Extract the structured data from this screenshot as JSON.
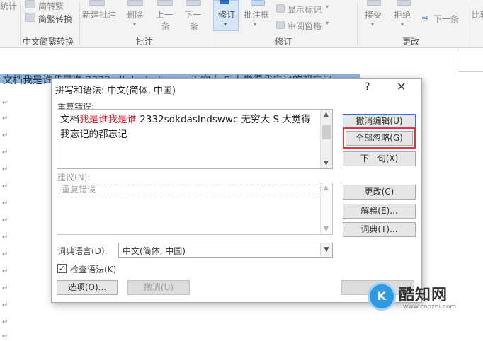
{
  "ribbon": {
    "stats_label": "统计",
    "trad_to_simp": "简转繁",
    "simp_trad_convert": "简繁转换",
    "new_comment": "新建批注",
    "delete_label": "删除",
    "prev_label": "上一",
    "prev_label2": "条",
    "next_label": "下一",
    "next_label2": "条",
    "track_label": "修订",
    "comment_box": "批注框",
    "show_markup": "显示标记",
    "review_pane": "审阅窗格",
    "accept": "接受",
    "reject": "拒绝",
    "next_change": "下一条",
    "compare": "比较",
    "groups": {
      "chinese_conversion": "中文简繁转换",
      "comments": "批注",
      "tracking": "修订",
      "changes": "更改"
    }
  },
  "document": {
    "selected_line": "文档我是谁我是谁 2332sdkdaslndswwc 无穷大 S 大觉得我忘记的都忘记"
  },
  "dialog": {
    "title": "拼写和语法: 中文(简体, 中国)",
    "help": "?",
    "close": "✕",
    "repeat_error_label": "重复错误:",
    "error_text_prefix": "文档",
    "error_text_highlight": "我是谁我是谁",
    "error_text_suffix": " 2332sdkdaslndswwc 无穷大 S 大觉得我忘记的都忘记",
    "suggestions_label": "建议(N):",
    "suggestion_item": "重复错误",
    "dictionary_language_label": "词典语言(D):",
    "dictionary_language_value": "中文(简体, 中国)",
    "check_grammar_label": "检查语法(K)",
    "check_grammar_checked": true,
    "buttons": {
      "undo_edit": "撤消编辑(U)",
      "ignore_all": "全部忽略(G)",
      "next_sentence": "下一句(X)",
      "change": "更改(C)",
      "explain": "解释(E)...",
      "thesaurus": "词典(T)...",
      "options": "选项(O)...",
      "undo": "撤消(U)"
    }
  },
  "watermark": {
    "logo_char": "K",
    "name": "酷知网",
    "url": "www.coozhi.com"
  }
}
